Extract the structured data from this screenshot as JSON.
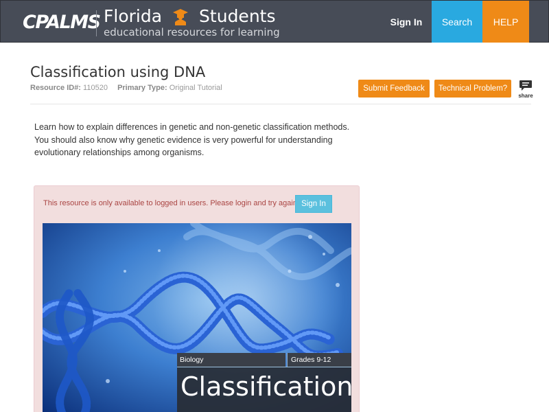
{
  "header": {
    "logo_text": "CPALMS",
    "brand_title_left": "Florida",
    "brand_title_right": "Students",
    "brand_subtitle": "educational resources for learning",
    "nav": {
      "signin": "Sign In",
      "search": "Search",
      "help": "HELP"
    },
    "colors": {
      "bar": "#474c57",
      "search": "#29a9e0",
      "help": "#ef8a17"
    }
  },
  "resource": {
    "title": "Classification using DNA",
    "id_label": "Resource ID#:",
    "id_value": "110520",
    "type_label": "Primary Type:",
    "type_value": "Original Tutorial",
    "buttons": {
      "feedback": "Submit Feedback",
      "technical": "Technical Problem?",
      "share": "share"
    },
    "description": [
      "Learn how to explain differences in genetic and non-genetic classification methods.",
      "You should also know why genetic evidence is very powerful for understanding",
      "evolutionary relationships among organisms."
    ]
  },
  "alert": {
    "message": "This resource is only available to logged in users. Please login and try again.",
    "signin_button": "Sign In"
  },
  "hero": {
    "subject": "Biology",
    "grades": "Grades 9-12",
    "title": "Classification",
    "icon": "dna-helix-image"
  }
}
